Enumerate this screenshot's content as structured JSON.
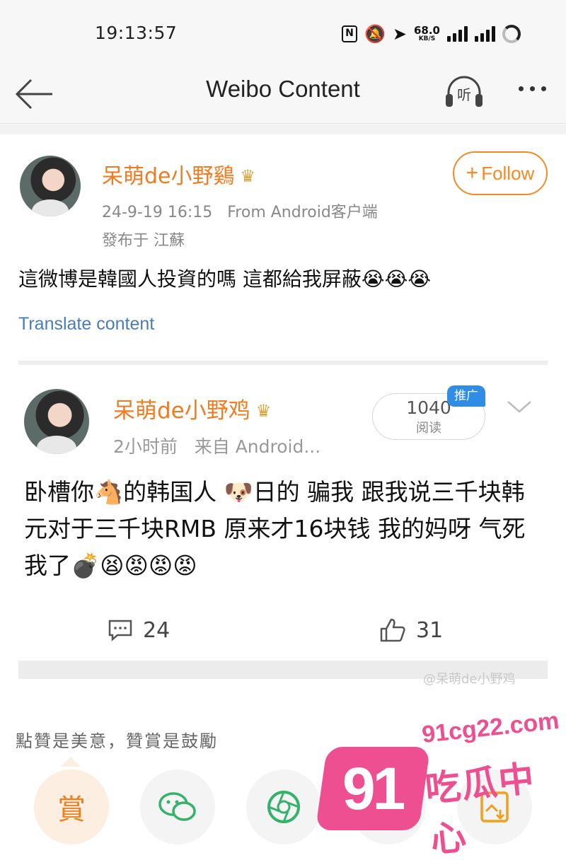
{
  "status_bar": {
    "time": "19:13:57",
    "speed_value": "68.0",
    "speed_unit": "KB/S",
    "icons": [
      "nfc-icon",
      "mute-icon",
      "location-icon",
      "signal-icon",
      "signal-icon",
      "battery-icon"
    ]
  },
  "header": {
    "title": "Weibo Content",
    "listen_label": "听"
  },
  "post": {
    "username": "呆萌de小野鷄",
    "follow_label": "Follow",
    "timestamp": "24-9-19 16:15",
    "source": "From Android客户端",
    "location": "發布于 江蘇",
    "text": "這微博是韓國人投資的嗎 這都給我屏蔽😭😭😭",
    "translate_label": "Translate content"
  },
  "embedded_post": {
    "username": "呆萌de小野鸡",
    "time": "2小时前",
    "source": "来自 Android...",
    "read_count": "1040",
    "read_label": "阅读",
    "promo_badge": "推广",
    "text": "卧槽你🐴的韩国人 🐶日的  骗我 跟我说三千块韩元对于三千块RMB  原来才16块钱   我的妈呀 气死我了💣😫😡😡😡",
    "comments": "24",
    "likes": "31",
    "watermark": "@呆萌de小野鸡"
  },
  "reward": {
    "text": "點贊是美意，贊賞是鼓勵",
    "reward_label": "賞"
  },
  "overlay_logo": {
    "mark": "91",
    "url": "91cg22.com",
    "name": "吃瓜中心"
  },
  "colors": {
    "accent_orange": "#f27b1f",
    "link_blue": "#4a7db6",
    "logo_pink": "#ee4f91"
  }
}
